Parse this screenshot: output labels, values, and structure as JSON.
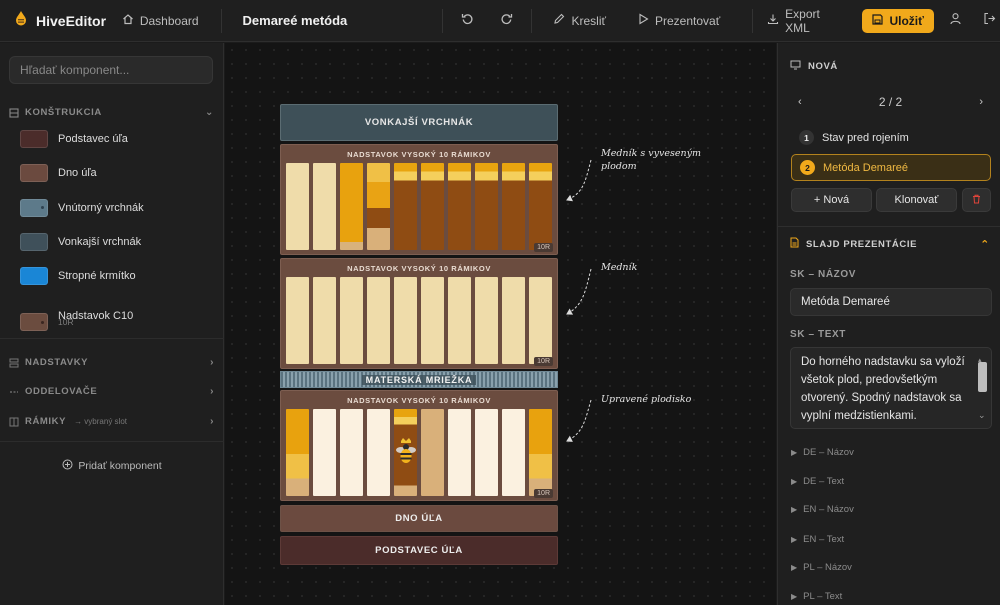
{
  "topbar": {
    "brand": "HiveEditor",
    "dashboard": "Dashboard",
    "doc_title": "Demareé metóda",
    "draw": "Kresliť",
    "present": "Prezentovať",
    "export": "Export XML",
    "save": "Uložiť",
    "accent": "#f1a91b"
  },
  "left": {
    "search_placeholder": "Hľadať komponent...",
    "sections": {
      "construction": "KONŠTRUKCIA",
      "supers": "NADSTAVKY",
      "dividers": "ODDELOVAČE",
      "frames": "RÁMIKY",
      "frames_hint": "→ vybraný slot"
    },
    "components": [
      {
        "label": "Podstavec úľa",
        "sub": "",
        "color": "#4b2c2a"
      },
      {
        "label": "Dno úľa",
        "sub": "",
        "color": "#6b4a3f"
      },
      {
        "label": "Vnútorný vrchnák",
        "sub": "",
        "color": "#5d7a8a"
      },
      {
        "label": "Vonkajší vrchnák",
        "sub": "",
        "color": "#3f505a"
      },
      {
        "label": "Stropné krmítko",
        "sub": "",
        "color": "#1a86d6"
      },
      {
        "label": "Nadstavok C10",
        "sub": "10R",
        "color": "#6b4c3f"
      }
    ],
    "add_component": "Pridať komponent"
  },
  "canvas": {
    "outer_lid": "VONKAJŠÍ VRCHNÁK",
    "super_title": "NADSTAVOK VYSOKÝ 10 RÁMIKOV",
    "frame_tag": "10R",
    "excluder": "MATERSKÁ MRIEŽKA",
    "bottom_board": "DNO ÚĽA",
    "stand": "PODSTAVEC ÚĽA",
    "annotations": {
      "a1_l1": "Medník s vyveseným",
      "a1_l2": "plodom",
      "a2": "Medník",
      "a3": "Upravené plodisko"
    }
  },
  "right": {
    "new_header": "NOVÁ",
    "pager": "2 / 2",
    "slides": [
      {
        "num": "1",
        "label": "Stav pred rojením"
      },
      {
        "num": "2",
        "label": "Metóda Demareé"
      }
    ],
    "new_btn": "+ Nová",
    "clone_btn": "Klonovať",
    "slide_header": "SLAJD PREZENTÁCIE",
    "sk_title_label": "SK – NÁZOV",
    "sk_title_value": "Metóda Demareé",
    "sk_text_label": "SK – TEXT",
    "sk_text_value": "Do horného nadstavku sa vyloží všetok plod, predovšetkým otvorený. Spodný nadstavok sa vyplní medzistienkami. Výsledkom je potlačenie rojovej",
    "collapsed": [
      "DE – Názov",
      "DE – Text",
      "EN – Názov",
      "EN – Text",
      "PL – Názov",
      "PL – Text"
    ]
  }
}
